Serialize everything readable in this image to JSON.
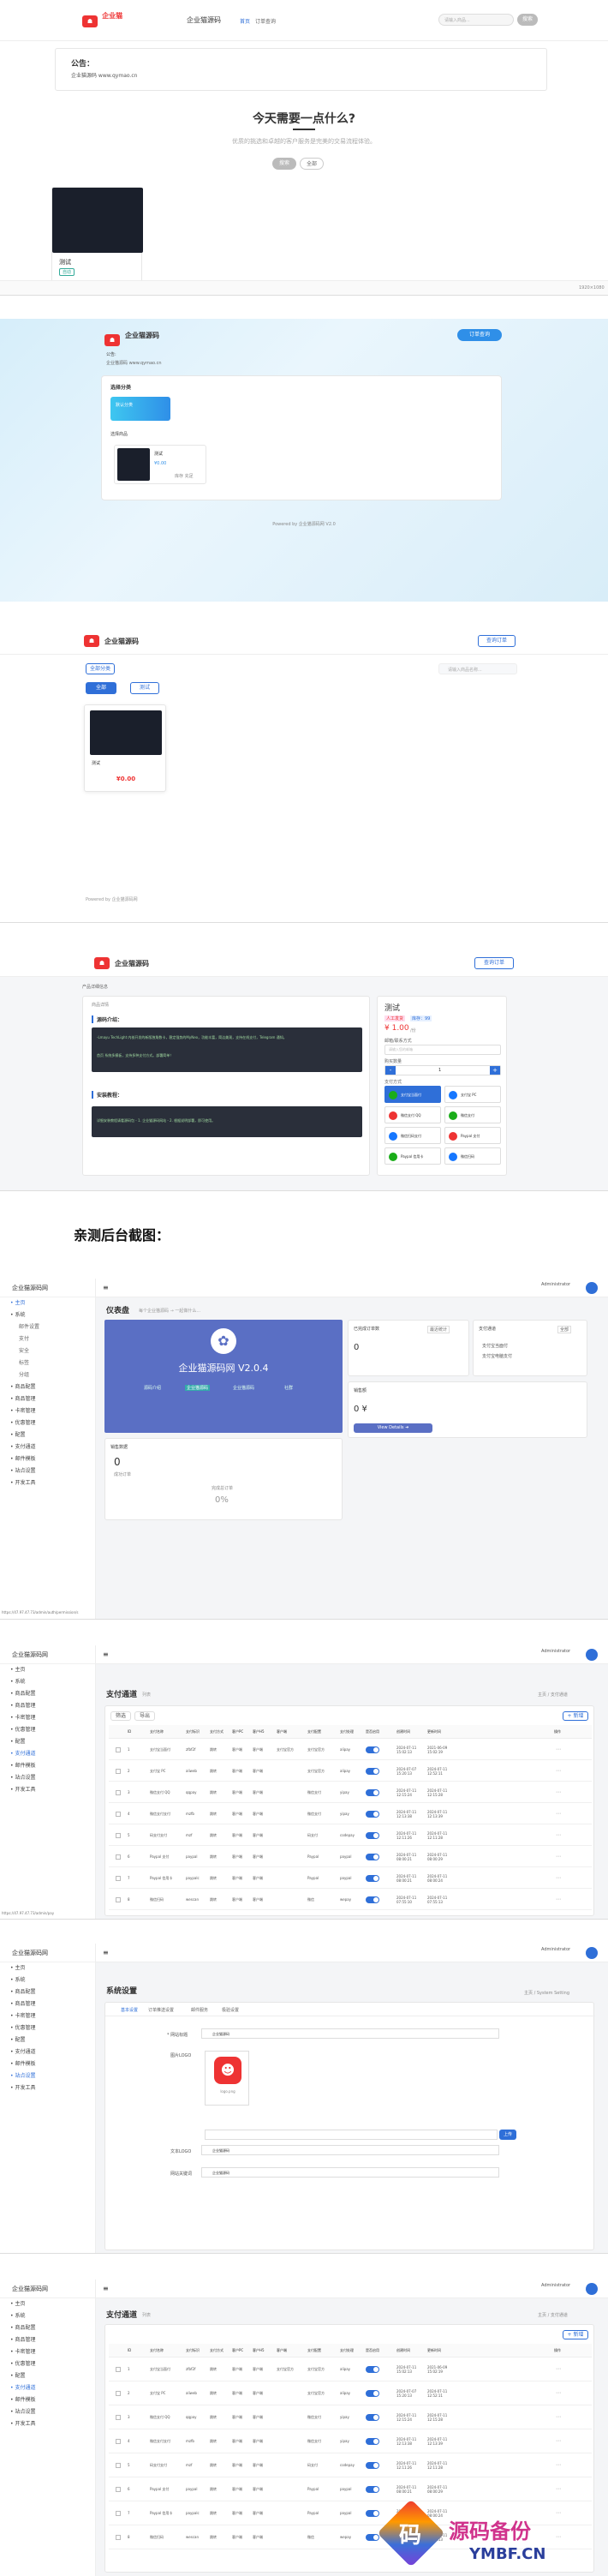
{
  "shop1": {
    "logo_text": "企业猫",
    "site_name": "企业猫源码",
    "nav": [
      "首页",
      "订单查询"
    ],
    "search_placeholder": "请输入商品...",
    "search_btn": "搜索",
    "notice_title": "公告：",
    "notice_text": "企业猫源码 www.qymao.cn",
    "hero_title": "今天需要一点什么?",
    "hero_sub": "优质的挑选和卓越的客户服务是完美的交易流程体验。",
    "hero_btn1": "搜索",
    "hero_btn2": "全部",
    "product_name": "测试",
    "product_tag": "自动",
    "statusbar": "1920×1080"
  },
  "shop2": {
    "site_name": "企业猫源码",
    "order_btn": "订单查询",
    "notice_title": "公告:",
    "notice_text": "企业猫源码 www.qymao.cn",
    "cat_title": "选择分类",
    "cat_item": "默认分类",
    "goods_title": "选择商品",
    "product_name": "测试",
    "product_price": "¥0.00",
    "product_stock": "库存 充足",
    "footer": "Powered by 企业猫源码网 V2.0"
  },
  "shop3": {
    "site_name": "企业猫源码",
    "order_btn": "查询订单",
    "cat_btn": "全部分类",
    "search_placeholder": "请输入商品名称...",
    "tab1": "全部",
    "tab2": "测试",
    "product_name": "测试",
    "product_price": "¥0.00",
    "footer": "Powered by 企业猫源码网"
  },
  "shop4": {
    "site_name": "企业猫源码",
    "order_btn": "查询订单",
    "breadcrumb": "产品详细信息",
    "tab": "商品详情",
    "intro_title": "源码介绍：",
    "intro_text_1": "-Lmayu TechLight 内核开发的新版独角数卡，稳定强势的MyNeo，功能丰富，简洁美观，支持在线支付，Telegram 通知。",
    "intro_text_2": "首页 系统多模板，支持多种支付方式。部署简单！",
    "install_title": "安装教程：",
    "install_text": "详细安装教程请看源码包 - 1. 企业猫源码网站 - 2. 根据说明部署，即可使用。",
    "product_name": "测试",
    "badge1": "人工发货",
    "badge2": "库存：99",
    "price": "¥ 1.00",
    "price_unit": "/份",
    "email_label": "邮箱/联系方式",
    "email_placeholder": "请输入您的邮箱",
    "qty_label": "购买数量",
    "qty_value": "1",
    "pay_label": "支付方式",
    "pay_methods": [
      "支付宝当面付",
      "支付宝 PC",
      "微信支付 QQ",
      "微信支付",
      "微信扫码支付",
      "Paypal 支付",
      "Paypal 信用卡",
      "微信扫码"
    ]
  },
  "caption": "亲测后台截图：",
  "admin_common": {
    "brand": "企业猫源码网",
    "user": "Administrator",
    "user_role": "管理员",
    "menu": [
      "主页",
      "系统",
      "商品配置",
      "商品管理",
      "卡密管理",
      "优惠管理",
      "配置",
      "支付通道",
      "邮件模板",
      "站点设置",
      "开发工具"
    ],
    "sub_system": [
      "邮件设置",
      "支付",
      "安全",
      "标签",
      "分组"
    ]
  },
  "admin1": {
    "title": "仪表盘",
    "subtitle": "每个企业猫源码 → 一起做什么...",
    "banner_title": "企业猫源码网 V2.0.4",
    "banner_links": [
      "源码介绍",
      "企业猫源码",
      "企业猫源码",
      "社群"
    ],
    "card1_title": "已完成订单数",
    "card1_value": "0",
    "card1_btn": "最近统计",
    "card2_title": "支付通道",
    "card2_items": [
      "支付宝当面付",
      "支付宝电脑支付"
    ],
    "card2_btn": "全部",
    "card3_title": "销售数据",
    "card3_value": "0",
    "card3_sub": "成功订单",
    "card3_rate_label": "完成总订单",
    "card3_rate": "0%",
    "card4_title": "销售额",
    "card4_value": "0 ¥",
    "card4_btn": "View Details ➜",
    "url": "https://47.97.47.73/admin/auth/permission/s"
  },
  "admin2": {
    "title": "支付通道",
    "title_sub": "列表",
    "breadcrumb": "主页 / 支付通道",
    "btn_filter": "筛选",
    "btn_export": "导出",
    "btn_new": "+ 新增",
    "columns": [
      "ID",
      "支付名称",
      "支付标识",
      "支付方式",
      "客户PC",
      "客户H5",
      "客户端",
      "支付配置",
      "支付处理",
      "是否启用",
      "创建时间",
      "更新时间",
      "操作"
    ],
    "rows": [
      [
        "1",
        "支付宝当面付",
        "zfbf2f",
        "跳转",
        "客户端",
        "客户端",
        "支付宝官方",
        "支付宝官方",
        "alipay",
        "启用",
        "2024-07-11 15:02:13",
        "2021-06-09 15:02:19"
      ],
      [
        "2",
        "支付宝 PC",
        "aliweb",
        "跳转",
        "客户端",
        "客户端",
        "",
        "支付宝官方",
        "alipay",
        "启用",
        "2024-07-07 15:20:13",
        "2024-07-11 12:52:11"
      ],
      [
        "3",
        "微信支付 QQ",
        "qqpay",
        "跳转",
        "客户端",
        "客户端",
        "",
        "微信支付",
        "yipay",
        "启用",
        "2024-07-11 12:15:24",
        "2024-07-11 12:15:28"
      ],
      [
        "4",
        "微信支付支付",
        "mzfb",
        "跳转",
        "客户端",
        "客户端",
        "",
        "微信支付",
        "yipay",
        "启用",
        "2024-07-11 12:13:38",
        "2024-07-11 12:13:39"
      ],
      [
        "5",
        "码支付支付",
        "mzf",
        "跳转",
        "客户端",
        "客户端",
        "",
        "码支付",
        "codepay",
        "启用",
        "2024-07-11 12:11:26",
        "2024-07-11 12:11:28"
      ],
      [
        "6",
        "Paypal 支付",
        "paypal",
        "跳转",
        "客户端",
        "客户端",
        "",
        "Paypal",
        "paypal",
        "启用",
        "2024-07-11 08:00:21",
        "2024-07-11 08:00:29"
      ],
      [
        "7",
        "Paypal 信用卡",
        "paypalc",
        "跳转",
        "客户端",
        "客户端",
        "",
        "Paypal",
        "paypal",
        "启用",
        "2024-07-11 08:00:21",
        "2024-07-11 08:00:24"
      ],
      [
        "8",
        "微信扫码",
        "wescan",
        "跳转",
        "客户端",
        "客户端",
        "",
        "微信",
        "wepay",
        "启用",
        "2024-07-11 07:55:10",
        "2024-07-11 07:55:13"
      ]
    ],
    "url": "https://47.97.47.73/admin/pay"
  },
  "admin3": {
    "title": "系统设置",
    "breadcrumb": "主页 / System Setting",
    "tabs": [
      "基本设置",
      "订单推送设置",
      "邮件服务",
      "极验设置"
    ],
    "field1_label": "* 网站标题",
    "field1_value": "企业猫源码",
    "field2_label": "图片LOGO",
    "logo_caption": "logo.png",
    "upload_btn": "上传",
    "field3_label": "文本LOGO",
    "field3_value": "企业猫源码",
    "field4_label": "网站关键词",
    "field4_value": "企业猫源码"
  },
  "admin4": {
    "title": "支付通道",
    "title_sub": "列表",
    "breadcrumb": "主页 / 支付通道",
    "btn_new": "+ 新增"
  },
  "watermark": {
    "text": "源码备份",
    "url": "YMBF.CN",
    "glyph": "码"
  },
  "colors": {
    "accent": "#2f6fd8",
    "red": "#e33b3b",
    "admin_banner": "#5a6fc4",
    "dark": "#1f2430"
  }
}
